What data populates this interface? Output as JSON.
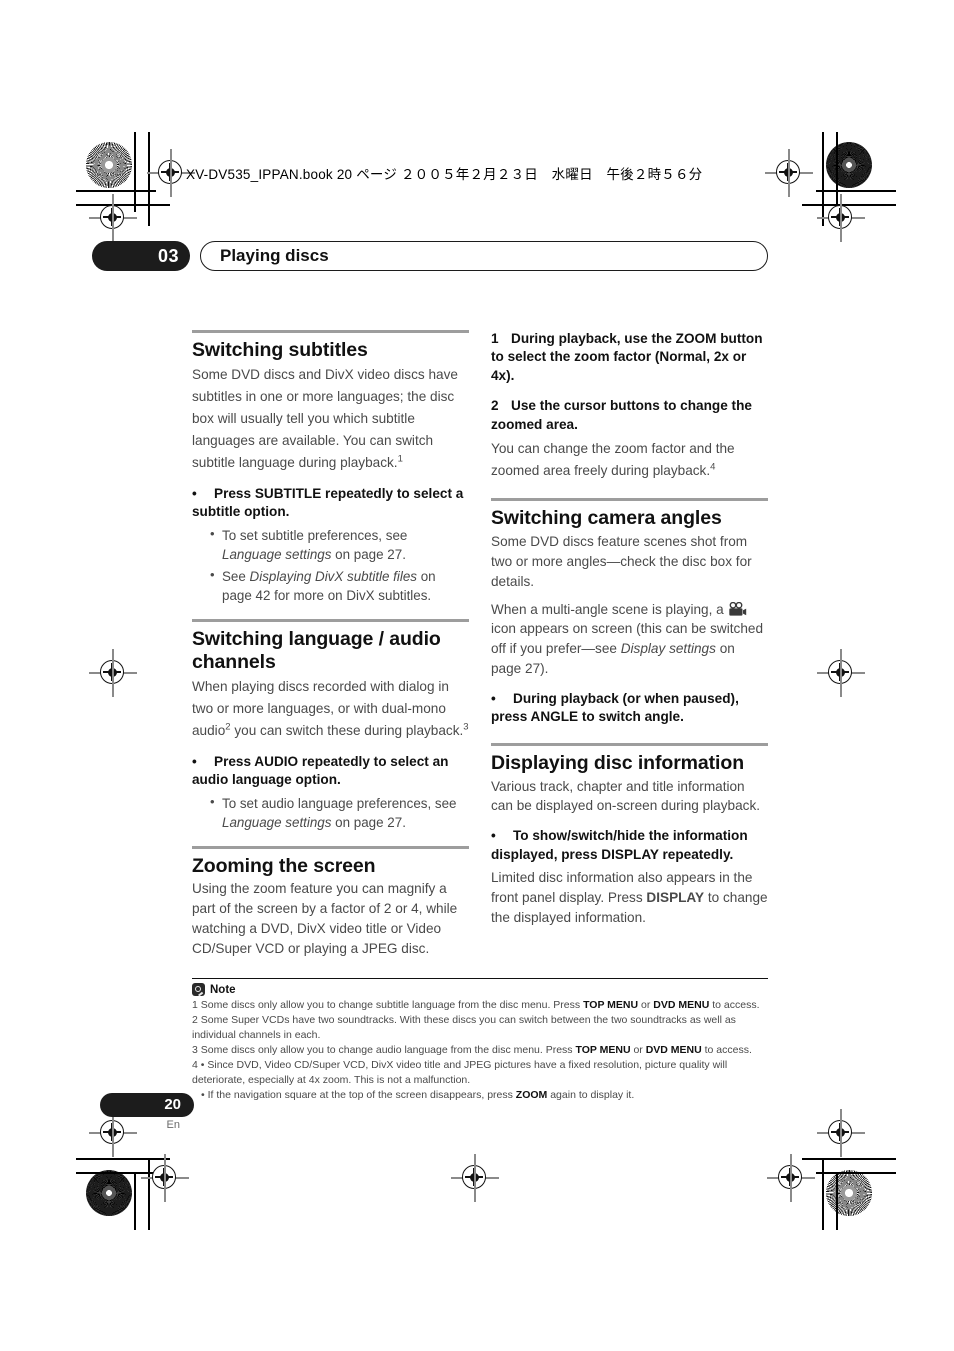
{
  "header": {
    "book_line": "XV-DV535_IPPAN.book  20 ページ  ２００５年２月２３日　水曜日　午後２時５６分",
    "chapter_number": "03",
    "chapter_title": "Playing discs"
  },
  "left_column": {
    "section1": {
      "heading": "Switching subtitles",
      "intro_a": "Some DVD discs and DivX video discs have subtitles in one or more languages; the disc box will usually tell you which subtitle languages are available. You can switch subtitle language during playback.",
      "intro_sup": "1",
      "action": "Press SUBTITLE repeatedly to select a subtitle option.",
      "subitem1_pre": "To set subtitle preferences, see ",
      "subitem1_em": "Language settings",
      "subitem1_post": " on page 27.",
      "subitem2_pre": "See ",
      "subitem2_em": "Displaying DivX subtitle files",
      "subitem2_post": " on page 42 for more on DivX subtitles."
    },
    "section2": {
      "heading": "Switching language / audio channels",
      "intro_a": "When playing discs recorded with dialog in two or more languages, or with dual-mono audio",
      "intro_sup_a": "2",
      "intro_b": " you can switch these during playback.",
      "intro_sup_b": "3",
      "action": "Press AUDIO repeatedly to select an audio language option.",
      "subitem1_pre": "To set audio language preferences, see ",
      "subitem1_em": "Language settings",
      "subitem1_post": " on page 27."
    },
    "section3": {
      "heading": "Zooming the screen",
      "intro": "Using the zoom feature you can magnify a part of the screen by a factor of 2 or 4, while watching a DVD, DivX video title or Video CD/Super VCD or playing a JPEG disc."
    }
  },
  "right_column": {
    "steps": {
      "step1_num": "1",
      "step1_text": "During playback, use the ZOOM button to select the zoom factor (Normal, 2x or 4x).",
      "step2_num": "2",
      "step2_text": "Use the cursor buttons to change the zoomed area.",
      "step2_body": "You can change the zoom factor and the zoomed area freely during playback.",
      "step2_body_sup": "4"
    },
    "section4": {
      "heading": "Switching camera angles",
      "intro_a": "Some DVD discs feature scenes shot from two or more angles—check the disc box for details.",
      "intro_b_pre": "When a multi-angle scene is playing, a ",
      "intro_b_icon": "movie-camera-icon",
      "intro_b_mid": " icon appears on screen (this can be switched off if you prefer—see ",
      "intro_b_em": "Display settings",
      "intro_b_post": " on page 27).",
      "action": "During playback (or when paused), press ANGLE to switch angle."
    },
    "section5": {
      "heading": "Displaying disc information",
      "intro": "Various track, chapter and title information can be displayed on-screen during playback.",
      "action": "To show/switch/hide the information displayed, press DISPLAY repeatedly.",
      "body_pre": "Limited disc information also appears in the front panel display. Press ",
      "body_bold": "DISPLAY",
      "body_post": " to change the displayed information."
    }
  },
  "notes": {
    "title": "Note",
    "icon": "note-pencil-icon",
    "items": [
      {
        "num": "1",
        "pre": "Some discs only allow you to change subtitle language from the disc menu. Press ",
        "b1": "TOP MENU",
        "mid": " or ",
        "b2": "DVD MENU",
        "post": " to access."
      },
      {
        "num": "2",
        "pre": "Some Super VCDs have two soundtracks. With these discs you can switch between the two soundtracks as well as individual channels in each.",
        "b1": "",
        "mid": "",
        "b2": "",
        "post": ""
      },
      {
        "num": "3",
        "pre": "Some discs only allow you to change audio language from the disc menu. Press ",
        "b1": "TOP MENU",
        "mid": " or ",
        "b2": "DVD MENU",
        "post": " to access."
      }
    ],
    "note4_num": "4",
    "note4_line1": "• Since DVD, Video CD/Super VCD, DivX video title and JPEG pictures have a fixed resolution, picture quality will deteriorate, especially at 4x zoom. This is not a malfunction.",
    "note4_line2_pre": "• If the navigation square at the top of the screen disappears, press ",
    "note4_line2_bold": "ZOOM",
    "note4_line2_post": " again to display it."
  },
  "footer": {
    "page_number": "20",
    "language": "En"
  },
  "colors": {
    "black": "#1c1c1c",
    "body_gray": "#4a4a4a",
    "rule_gray": "#9d9d9d"
  }
}
